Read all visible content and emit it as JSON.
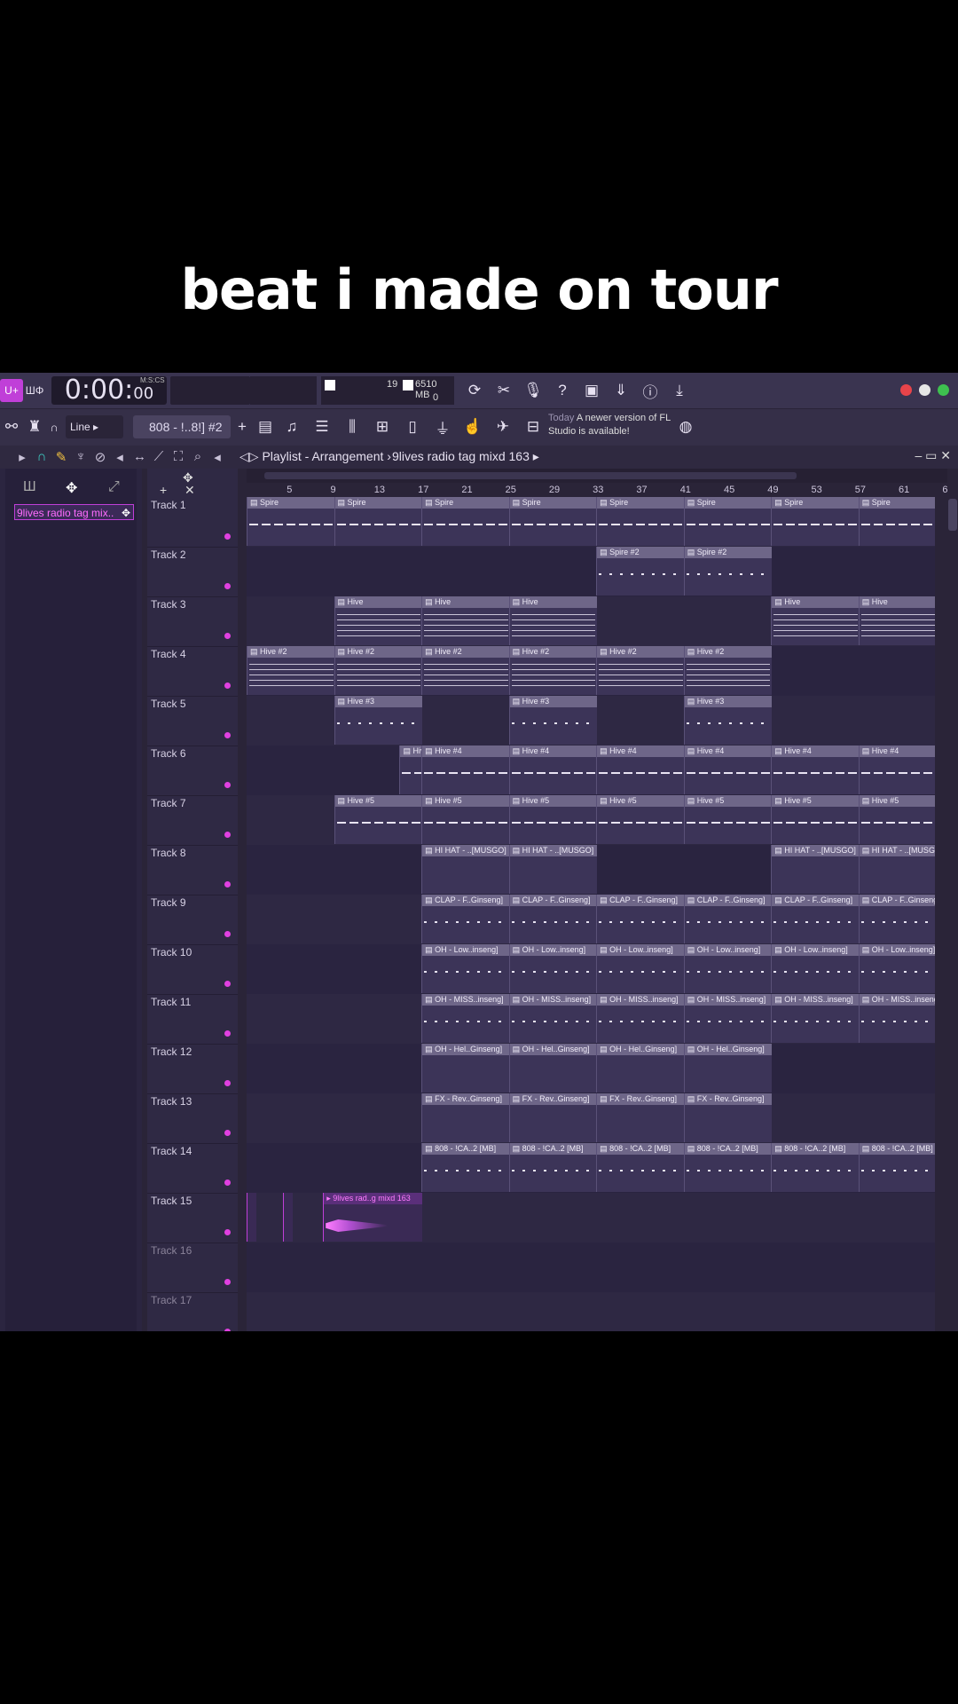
{
  "caption": "beat i made on tour",
  "toolbar": {
    "time_main": "0:00:",
    "time_small": "00",
    "time_label": "M:S:CS",
    "cpu_value": "19",
    "mem_value": "6510 MB",
    "poly_value": "0",
    "snap": "Line",
    "pattern": "808 - !..8!] #2",
    "news_today": "Today",
    "news_text": "A newer version of FL Studio is available!",
    "dot_colors": [
      "#e8444a",
      "#e6e6e6",
      "#3ec14f"
    ]
  },
  "playlist": {
    "title": "Playlist - Arrangement",
    "breadcrumb": "9lives radio tag mixd 163",
    "clip_label": "9lives radio tag mix..",
    "ruler": [
      "5",
      "9",
      "13",
      "17",
      "21",
      "25",
      "29",
      "33",
      "37",
      "41",
      "45",
      "49",
      "53",
      "57",
      "61",
      "6"
    ]
  },
  "tracks": [
    "Track 1",
    "Track 2",
    "Track 3",
    "Track 4",
    "Track 5",
    "Track 6",
    "Track 7",
    "Track 8",
    "Track 9",
    "Track 10",
    "Track 11",
    "Track 12",
    "Track 13",
    "Track 14",
    "Track 15",
    "Track 16",
    "Track 17"
  ],
  "clips": [
    {
      "track": 0,
      "label": "Spire",
      "starts": [
        1,
        9,
        17,
        25,
        33,
        41,
        49,
        57
      ],
      "len": 8,
      "style": "line"
    },
    {
      "track": 1,
      "label": "Spire #2",
      "starts": [
        33,
        41
      ],
      "len": 8,
      "style": "dots"
    },
    {
      "track": 2,
      "label": "Hive",
      "starts": [
        9,
        17,
        25
      ],
      "len": 8,
      "style": "dense"
    },
    {
      "track": 2,
      "label": "Hive",
      "starts": [
        49,
        57
      ],
      "len": 8,
      "style": "dense"
    },
    {
      "track": 3,
      "label": "Hive #2",
      "starts": [
        1,
        9,
        17,
        25,
        33,
        41
      ],
      "len": 8,
      "style": "dense"
    },
    {
      "track": 4,
      "label": "Hive #3",
      "starts": [
        9,
        25,
        41
      ],
      "len": 8,
      "style": "dots"
    },
    {
      "track": 5,
      "label": "Hive #4",
      "starts": [
        15,
        17,
        25,
        33,
        41,
        49,
        57
      ],
      "len": 8,
      "style": "line"
    },
    {
      "track": 6,
      "label": "Hive #5",
      "starts": [
        9,
        17,
        25,
        33,
        41,
        49,
        57
      ],
      "len": 8,
      "style": "line"
    },
    {
      "track": 7,
      "label": "HI HAT - ..[MUSGO]",
      "starts": [
        17,
        25
      ],
      "len": 8,
      "style": "none"
    },
    {
      "track": 7,
      "label": "HI HAT - ..[MUSGO]",
      "starts": [
        49,
        57
      ],
      "len": 8,
      "style": "none"
    },
    {
      "track": 8,
      "label": "CLAP - F..Ginseng]",
      "starts": [
        17,
        25,
        33,
        41,
        49,
        57
      ],
      "len": 8,
      "style": "dots"
    },
    {
      "track": 9,
      "label": "OH - Low..inseng]",
      "starts": [
        17,
        25,
        33,
        41,
        49,
        57
      ],
      "len": 8,
      "style": "dots"
    },
    {
      "track": 10,
      "label": "OH - MISS..inseng]",
      "starts": [
        17,
        25,
        33,
        41,
        49,
        57
      ],
      "len": 8,
      "style": "dots"
    },
    {
      "track": 11,
      "label": "OH - Hel..Ginseng]",
      "starts": [
        17,
        25,
        33,
        41
      ],
      "len": 8,
      "style": "none"
    },
    {
      "track": 12,
      "label": "FX - Rev..Ginseng]",
      "starts": [
        17,
        25,
        33,
        41
      ],
      "len": 8,
      "style": "none"
    },
    {
      "track": 13,
      "label": "808 - !CA..2 [MB]",
      "starts": [
        17,
        25,
        33,
        41,
        49,
        57
      ],
      "len": 8,
      "style": "dots"
    }
  ],
  "audio_clip": {
    "label": "9lives rad..g mixd 163"
  }
}
